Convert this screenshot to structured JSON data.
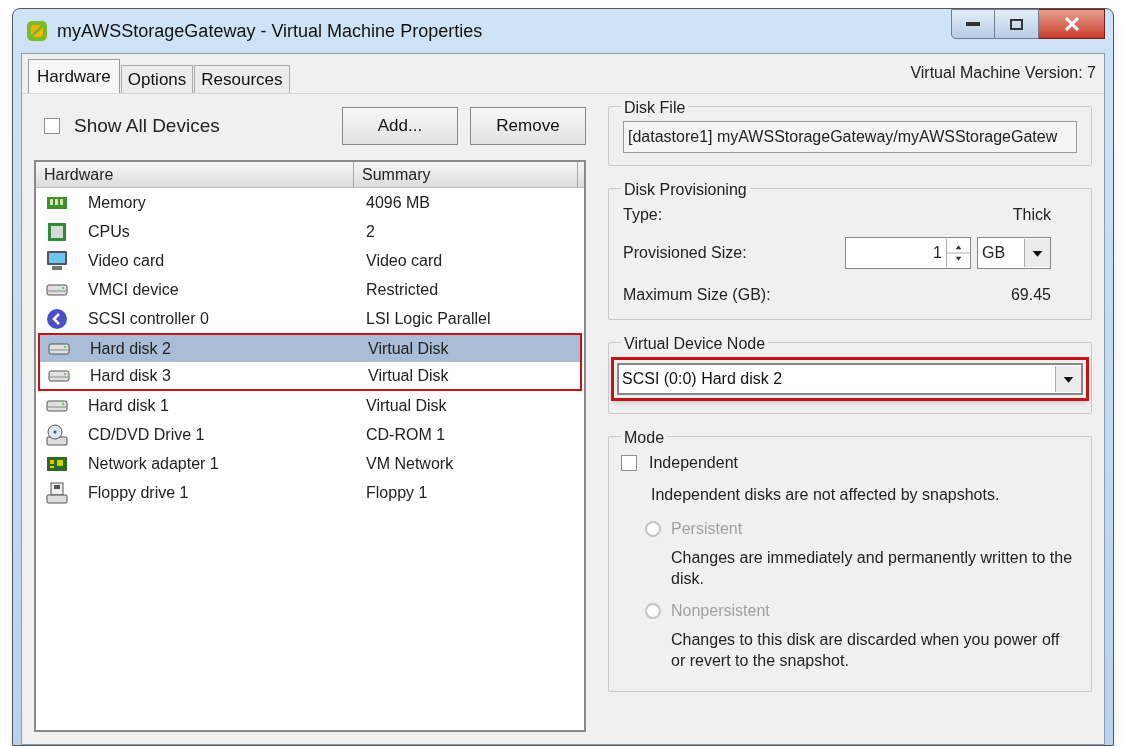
{
  "window": {
    "title": "myAWSStorageGateway - Virtual Machine Properties"
  },
  "tabs": [
    {
      "label": "Hardware",
      "selected": true
    },
    {
      "label": "Options",
      "selected": false
    },
    {
      "label": "Resources",
      "selected": false
    }
  ],
  "version": "Virtual Machine Version: 7",
  "show_all_devices": {
    "label": "Show All Devices",
    "checked": false
  },
  "buttons": [
    "Add...",
    "Remove"
  ],
  "table": {
    "columns": [
      "Hardware",
      "Summary"
    ],
    "rows": [
      {
        "kind": "memory",
        "name": "Memory",
        "summary": "4096 MB",
        "selected": false,
        "annotated": false
      },
      {
        "kind": "cpu",
        "name": "CPUs",
        "summary": "2",
        "selected": false,
        "annotated": false
      },
      {
        "kind": "monitor",
        "name": "Video card",
        "summary": "Video card",
        "selected": false,
        "annotated": false
      },
      {
        "kind": "disk",
        "name": "VMCI device",
        "summary": "Restricted",
        "selected": false,
        "annotated": false
      },
      {
        "kind": "scsi",
        "name": "SCSI controller 0",
        "summary": "LSI Logic Parallel",
        "selected": false,
        "annotated": false
      },
      {
        "kind": "disk",
        "name": "Hard disk 2",
        "summary": "Virtual Disk",
        "selected": true,
        "annotated": true
      },
      {
        "kind": "disk",
        "name": "Hard disk 3",
        "summary": "Virtual Disk",
        "selected": false,
        "annotated": true
      },
      {
        "kind": "disk",
        "name": "Hard disk 1",
        "summary": "Virtual Disk",
        "selected": false,
        "annotated": false
      },
      {
        "kind": "cdrom",
        "name": "CD/DVD Drive 1",
        "summary": "CD-ROM 1",
        "selected": false,
        "annotated": false
      },
      {
        "kind": "network",
        "name": "Network adapter 1",
        "summary": "VM Network",
        "selected": false,
        "annotated": false
      },
      {
        "kind": "floppy",
        "name": "Floppy drive 1",
        "summary": "Floppy 1",
        "selected": false,
        "annotated": false
      }
    ]
  },
  "disk_file": {
    "title": "Disk File",
    "value": "[datastore1] myAWSStorageGateway/myAWSStorageGatew"
  },
  "disk_provisioning": {
    "title": "Disk Provisioning",
    "type_label": "Type:",
    "type_value": "Thick",
    "size_label": "Provisioned Size:",
    "size_value": "1",
    "unit": "GB",
    "max_label": "Maximum Size (GB):",
    "max_value": "69.45"
  },
  "virtual_device_node": {
    "title": "Virtual Device Node",
    "value": "SCSI (0:0) Hard disk 2",
    "annotated": true
  },
  "mode": {
    "title": "Mode",
    "independent": {
      "label": "Independent",
      "checked": false
    },
    "note": "Independent disks are not affected by snapshots.",
    "options": [
      {
        "label": "Persistent",
        "selected": false,
        "disabled": true,
        "description": "Changes are immediately and permanently written to the disk."
      },
      {
        "label": "Nonpersistent",
        "selected": false,
        "disabled": true,
        "description": "Changes to this disk are discarded when you power off or revert to the snapshot."
      }
    ]
  }
}
